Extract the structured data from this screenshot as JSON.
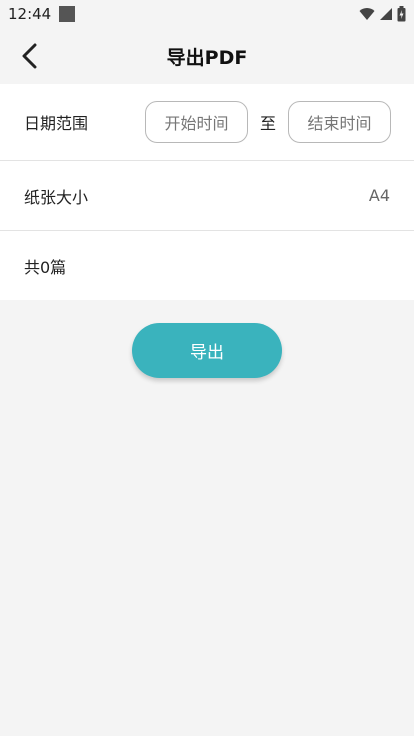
{
  "status_bar": {
    "time": "12:44",
    "icons": [
      "notification-square-icon",
      "wifi-icon",
      "cellular-signal-icon",
      "battery-icon"
    ]
  },
  "header": {
    "back_icon": "chevron-left-icon",
    "title": "导出PDF"
  },
  "form": {
    "date_range": {
      "label": "日期范围",
      "start_placeholder": "开始时间",
      "separator": "至",
      "end_placeholder": "结束时间"
    },
    "paper_size": {
      "label": "纸张大小",
      "value": "A4"
    },
    "count": {
      "label": "共0篇"
    }
  },
  "export_button": {
    "label": "导出"
  },
  "colors": {
    "accent": "#3ab3bd",
    "background": "#f4f4f4",
    "card": "#ffffff"
  }
}
